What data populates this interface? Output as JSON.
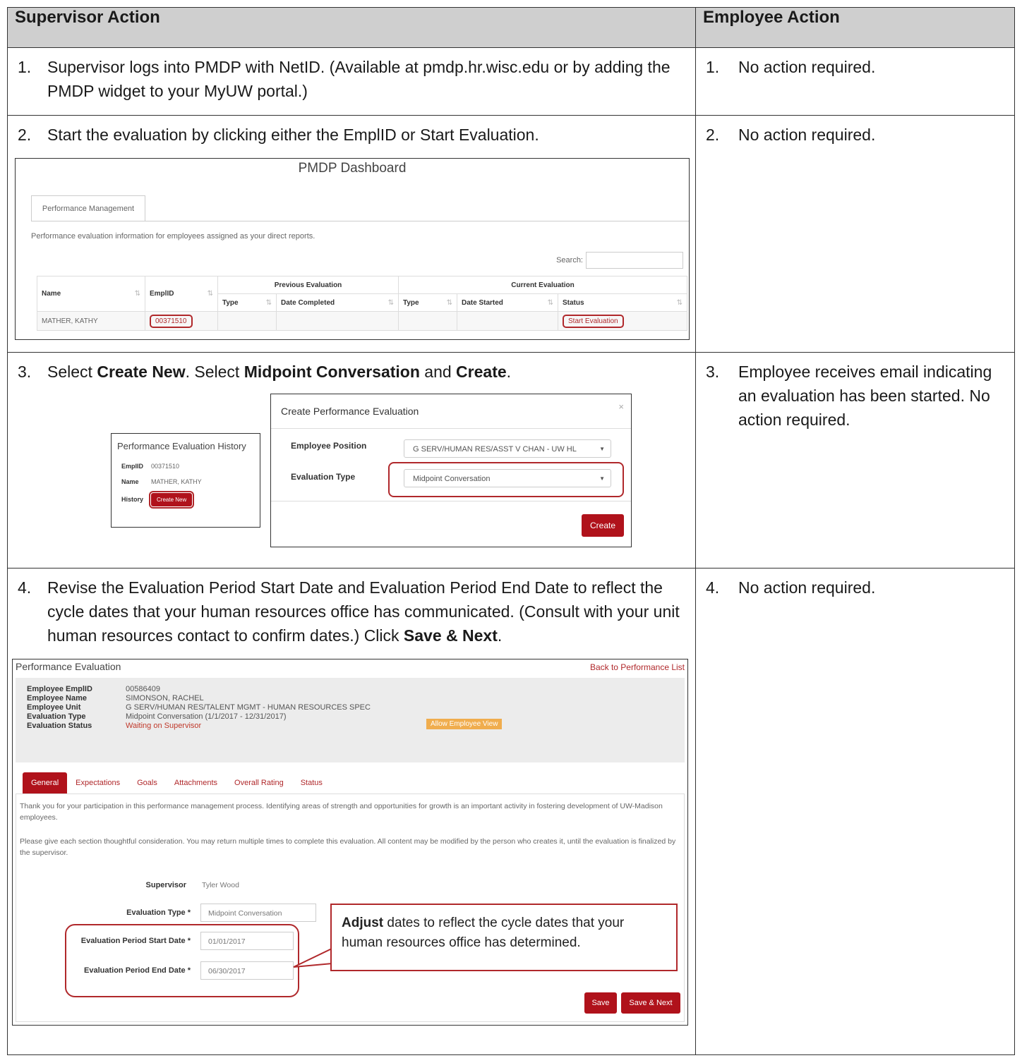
{
  "headers": {
    "supervisor": "Supervisor Action",
    "employee": "Employee Action"
  },
  "steps": [
    {
      "num": "1.",
      "text": "Supervisor logs into PMDP with NetID. (Available at pmdp.hr.wisc.edu or by adding the PMDP widget to your MyUW portal.)",
      "emp_num": "1.",
      "emp_text": "No action required."
    },
    {
      "num": "2.",
      "text": "Start the evaluation by clicking either the EmplID or Start Evaluation.",
      "emp_num": "2.",
      "emp_text": "No action required."
    },
    {
      "num": "3.",
      "text_a": "Select ",
      "bold_a": "Create New",
      "text_b": ". Select ",
      "bold_b": "Midpoint Conversation",
      "text_c": " and ",
      "bold_c": "Create",
      "text_d": ".",
      "emp_num": "3.",
      "emp_text": "Employee receives email indicating an evaluation has been started. No action required."
    },
    {
      "num": "4.",
      "text_a": "Revise the Evaluation Period Start Date and Evaluation Period End Date to reflect the cycle dates that your human resources office has communicated. (Consult with your unit human resources contact to confirm dates.) Click ",
      "bold_a": "Save & Next",
      "text_b": ".",
      "emp_num": "4.",
      "emp_text": "No action required."
    }
  ],
  "dashboard": {
    "title": "PMDP Dashboard",
    "tab": "Performance Management",
    "info": "Performance evaluation information for employees assigned as your direct reports.",
    "search_label": "Search:",
    "group_prev": "Previous Evaluation",
    "group_curr": "Current Evaluation",
    "cols": {
      "name": "Name",
      "emplid": "EmplID",
      "type1": "Type",
      "date_completed": "Date Completed",
      "type2": "Type",
      "date_started": "Date Started",
      "status": "Status"
    },
    "row": {
      "name": "MATHER, KATHY",
      "emplid": "00371510",
      "status": "Start Evaluation"
    }
  },
  "history": {
    "title": "Performance Evaluation History",
    "emplid_label": "EmplID",
    "emplid": "00371510",
    "name_label": "Name",
    "name": "MATHER, KATHY",
    "history_label": "History",
    "create_new": "Create New"
  },
  "modal": {
    "title": "Create Performance Evaluation",
    "close": "×",
    "position_label": "Employee Position",
    "position_value": "G SERV/HUMAN RES/ASST V CHAN - UW HL",
    "type_label": "Evaluation Type",
    "type_value": "Midpoint Conversation",
    "create": "Create"
  },
  "perf": {
    "title": "Performance Evaluation",
    "back": "Back to Performance List",
    "info": [
      {
        "k": "Employee EmplID",
        "v": "00586409"
      },
      {
        "k": "Employee Name",
        "v": "SIMONSON, RACHEL"
      },
      {
        "k": "Employee Unit",
        "v": "G SERV/HUMAN RES/TALENT MGMT - HUMAN RESOURCES SPEC"
      },
      {
        "k": "Evaluation Type",
        "v": "Midpoint Conversation (1/1/2017 - 12/31/2017)"
      },
      {
        "k": "Evaluation Status",
        "v": "Waiting on Supervisor"
      }
    ],
    "allow": "Allow Employee View",
    "tabs": [
      "General",
      "Expectations",
      "Goals",
      "Attachments",
      "Overall Rating",
      "Status"
    ],
    "para1": "Thank you for your participation in this performance management process. Identifying areas of strength and opportunities for growth is an important activity in fostering development of UW-Madison employees.",
    "para2": "Please give each section thoughtful consideration. You may return multiple times to complete this evaluation. All content may be modified by the person who creates it, until the evaluation is finalized by the supervisor.",
    "supervisor_label": "Supervisor",
    "supervisor": "Tyler Wood",
    "type_label": "Evaluation Type *",
    "type_value": "Midpoint Conversation",
    "start_label": "Evaluation Period Start Date *",
    "start_value": "01/01/2017",
    "end_label": "Evaluation Period End Date *",
    "end_value": "06/30/2017",
    "callout_bold": "Adjust",
    "callout_text": " dates to reflect the cycle dates that your human resources office has determined.",
    "save": "Save",
    "save_next": "Save & Next"
  }
}
